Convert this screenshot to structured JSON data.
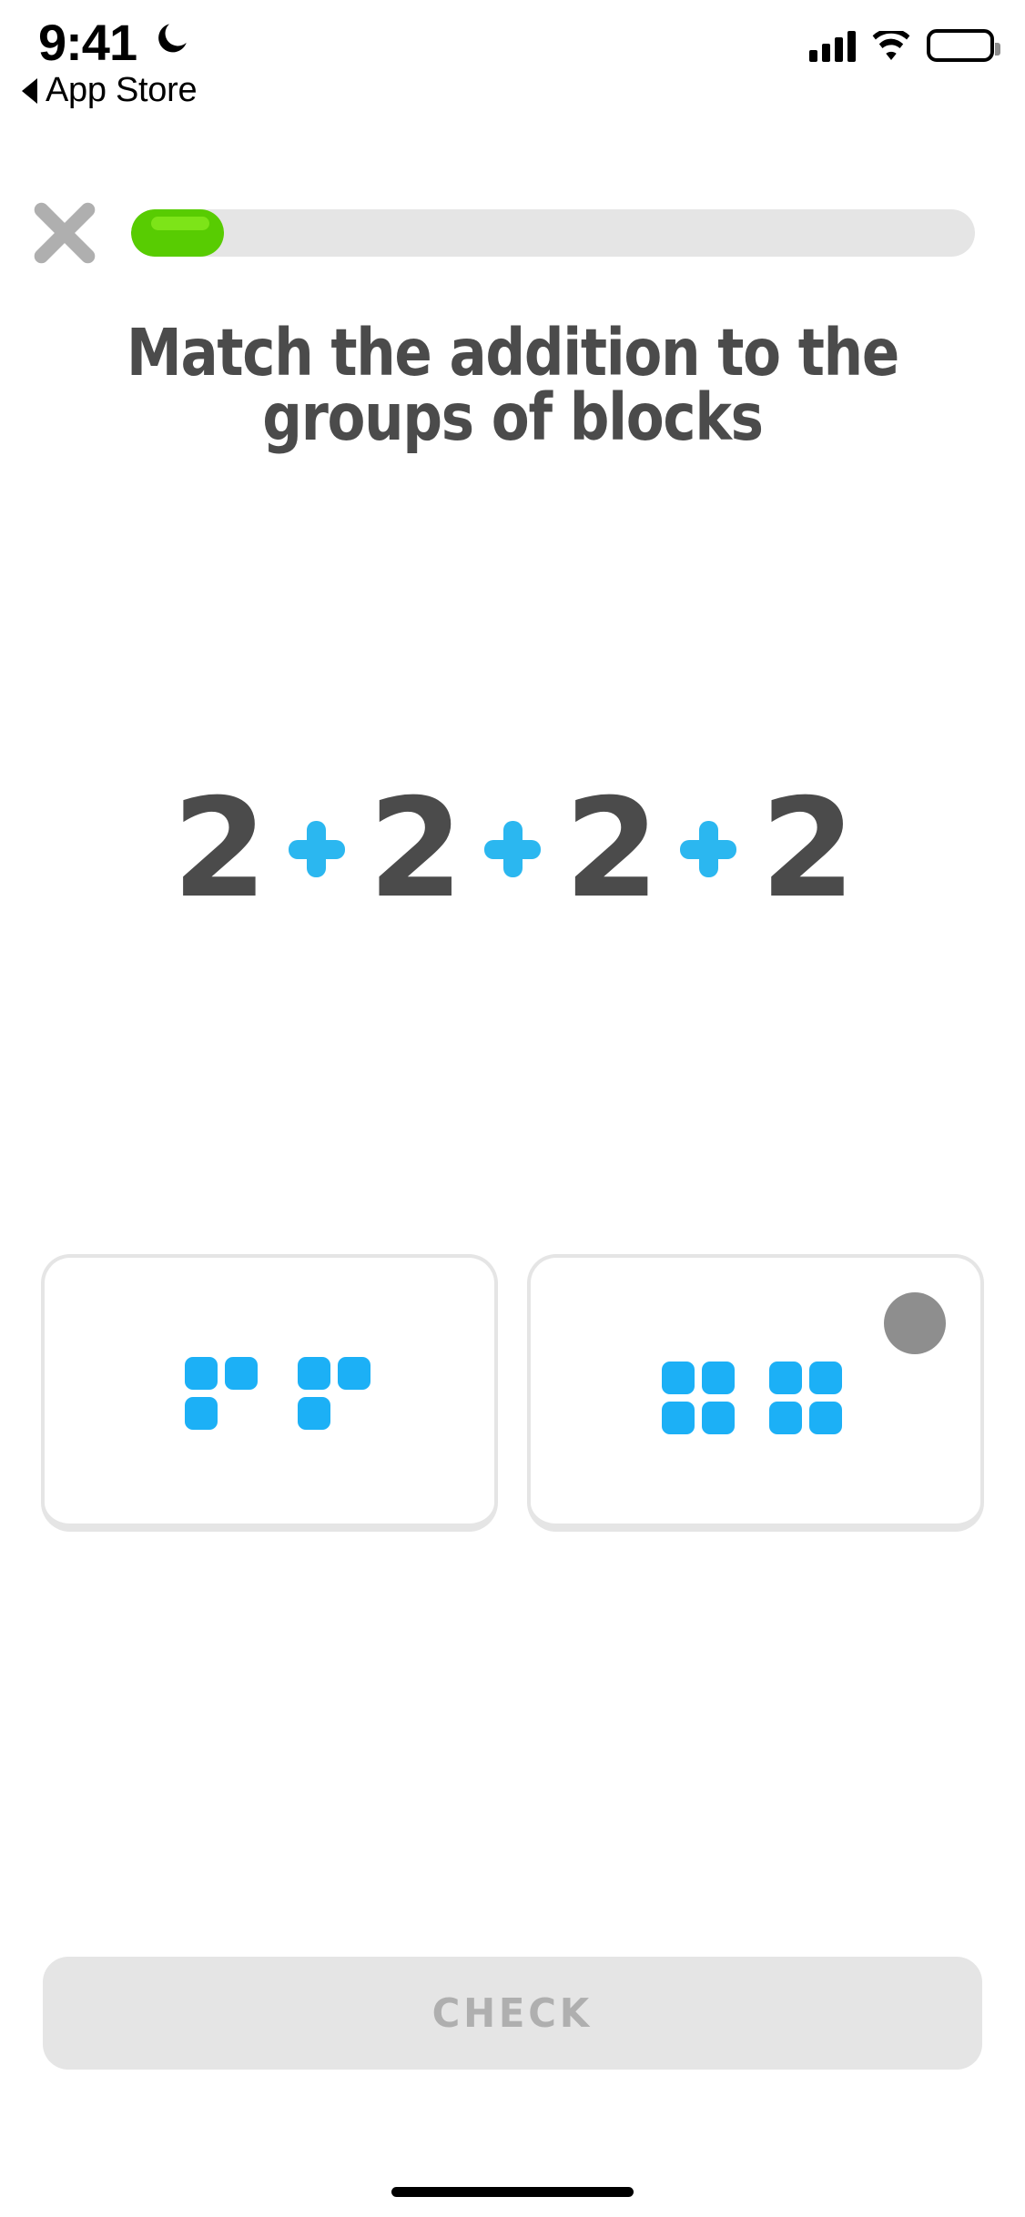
{
  "status_bar": {
    "time": "9:41",
    "dnd_icon": "moon-icon",
    "back_label": "App Store",
    "back_icon": "back-triangle-icon",
    "signal_icon": "cellular-signal-icon",
    "wifi_icon": "wifi-icon",
    "battery_icon": "battery-full-icon"
  },
  "header": {
    "close_icon": "close-x-icon",
    "progress": {
      "label": "lesson-progress",
      "percent": 11,
      "fill_color": "#58CC02",
      "track_color": "#E5E5E5"
    }
  },
  "lesson": {
    "title": "Match the addition to the groups of blocks",
    "title_color": "#4B4B4B"
  },
  "equation": {
    "terms": [
      "2",
      "2",
      "2",
      "2"
    ],
    "operator": "+",
    "number_color": "#4B4B4B",
    "operator_color": "#2BB7F0"
  },
  "answers": {
    "block_color": "#1CB0F6",
    "card_border_color": "#E5E5E5",
    "options": [
      {
        "id": "option-a",
        "selected": false,
        "marker": null,
        "groups": [
          {
            "rows": [
              [
                1,
                1
              ],
              [
                1,
                0
              ]
            ]
          },
          {
            "rows": [
              [
                1,
                1
              ],
              [
                1,
                0
              ]
            ]
          }
        ]
      },
      {
        "id": "option-b",
        "selected": false,
        "marker": "gray-circle-marker",
        "marker_color": "#8E8E8E",
        "groups": [
          {
            "rows": [
              [
                1,
                1
              ],
              [
                1,
                1
              ]
            ]
          },
          {
            "rows": [
              [
                1,
                1
              ],
              [
                1,
                1
              ]
            ]
          }
        ]
      }
    ]
  },
  "footer": {
    "check_label": "CHECK",
    "check_enabled": false,
    "check_bg": "#E5E5E5",
    "check_text_color": "#AFAFAF"
  }
}
